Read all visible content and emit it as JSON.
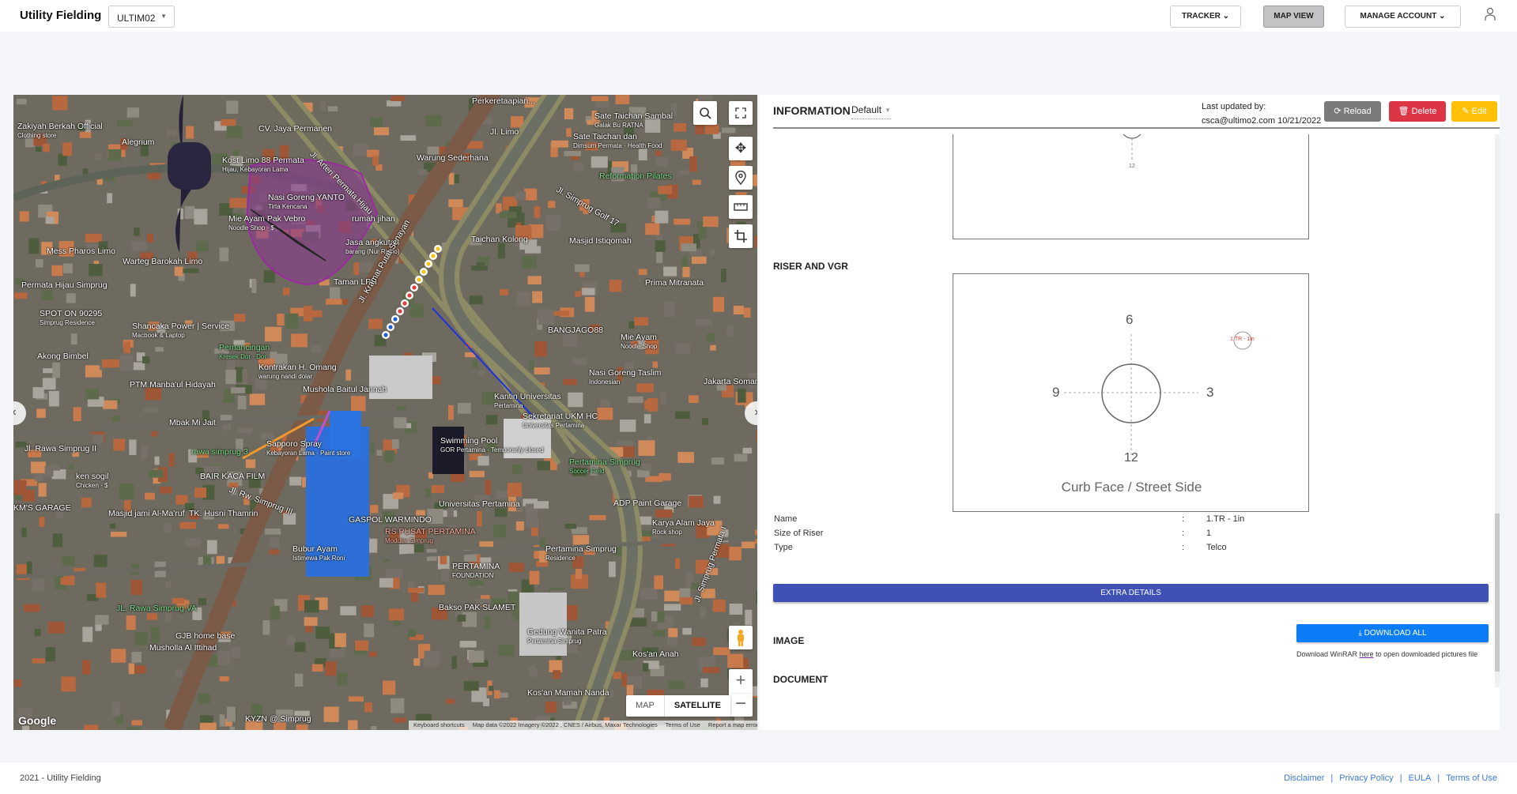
{
  "header": {
    "title": "Utility Fielding",
    "project_select": "ULTIM02",
    "nav": [
      {
        "label": "TRACKER",
        "icon": "chevron-down"
      },
      {
        "label": "MAP VIEW",
        "active": true
      },
      {
        "label": "MANAGE ACCOUNT",
        "icon": "chevron-down"
      }
    ],
    "user_icon": "user-icon"
  },
  "map": {
    "type_buttons": {
      "map": "MAP",
      "satellite": "SATELLITE",
      "selected": "SATELLITE"
    },
    "logo": "Google",
    "attribution": [
      "Keyboard shortcuts",
      "Map data ©2022 Imagery ©2022 , CNES / Airbus, Maxar Technologies",
      "Terms of Use",
      "Report a map error"
    ],
    "labels": [
      {
        "t": "Zakiyah Berkah Official",
        "s": "Clothing store"
      },
      {
        "t": "Alegrium"
      },
      {
        "t": "CV. Jaya Permanen"
      },
      {
        "t": "Kost Limo 88 Permata",
        "s": "Hijau, Kebayoran Lama"
      },
      {
        "t": "Nasi Goreng YANTO",
        "s": "Tirta Kencana"
      },
      {
        "t": "Mie Ayam Pak Vebro",
        "s": "Noodle Shop · $"
      },
      {
        "t": "Mess Pharos Limo"
      },
      {
        "t": "Warteg Barokah Limo"
      },
      {
        "t": "Permata Hijau Simprug"
      },
      {
        "t": "SPOT ON 90295",
        "s": "Simprug Residence"
      },
      {
        "t": "Shancaka Power | Service",
        "s": "Macbook & Laptop"
      },
      {
        "t": "Pemancingan",
        "s": "Kresek Dor - Dor"
      },
      {
        "t": "Akong Bimbel"
      },
      {
        "t": "Kontrakan H. Omang",
        "s": "warung nandi dolar"
      },
      {
        "t": "PTM Manba'ul Hidayah"
      },
      {
        "t": "Mushola Baitul Jannah"
      },
      {
        "t": "rumah jihan"
      },
      {
        "t": "Jasa angkutan",
        "s": "barang (Nur Ridho)"
      },
      {
        "t": "Taman LPH"
      },
      {
        "t": "Perkeretaapian..."
      },
      {
        "t": "Jl. Limo"
      },
      {
        "t": "Warung Sederhana"
      },
      {
        "t": "Sate Taichan Sambal",
        "s": "Galak Bu RATNA"
      },
      {
        "t": "Sate Taichan dan",
        "s": "Dimsum Permata · Health Food"
      },
      {
        "t": "Reformation Pilates"
      },
      {
        "t": "Taichan Kolong"
      },
      {
        "t": "Masjid Istiqomah"
      },
      {
        "t": "Prima Mitranata"
      },
      {
        "t": "BANGJAGO88"
      },
      {
        "t": "Mie Ayam",
        "s": "Noodle Shop"
      },
      {
        "t": "Nasi Goreng Taslim",
        "s": "Indonesian"
      },
      {
        "t": "Jakarta Soman"
      },
      {
        "t": "Kantin Universitas",
        "s": "Pertamina"
      },
      {
        "t": "Mbak Mi Jait"
      },
      {
        "t": "Jl. Rawa Simprug II"
      },
      {
        "t": "rawa simprug 3"
      },
      {
        "t": "Sapporo Spray",
        "s": "Kebayoran Lama · Paint store"
      },
      {
        "t": "BAIR KACA FILM"
      },
      {
        "t": "ken sogil",
        "s": "Chicken · $"
      },
      {
        "t": "KM'S GARAGE"
      },
      {
        "t": "Masjid jami Al-Ma'ruf"
      },
      {
        "t": "TK. Husni Thamrin"
      },
      {
        "t": "GASPOL WARMINDO"
      },
      {
        "t": "Bubur Ayam",
        "s": "Istimewa Pak Roni"
      },
      {
        "t": "JL. Rawa Simprug VA"
      },
      {
        "t": "GJB home base"
      },
      {
        "t": "Musholla Al Ittihad"
      },
      {
        "t": "KYZN @ Simprug"
      },
      {
        "t": "Sekretariat UKM HC",
        "s": "Universitas Pertamina"
      },
      {
        "t": "Swimming Pool",
        "s": "GOR Pertamina · Temporarily closed"
      },
      {
        "t": "Pertamina Simprug",
        "s": "Soccer Field"
      },
      {
        "t": "Universitas Pertamina"
      },
      {
        "t": "ADP Paint Garage"
      },
      {
        "t": "Karya Alam Jaya",
        "s": "Rock shop"
      },
      {
        "t": "RS PUSAT PERTAMINA",
        "s": "Modular Simprug"
      },
      {
        "t": "Pertamina Simprug",
        "s": "Residence"
      },
      {
        "t": "PERTAMINA",
        "s": "FOUNDATION"
      },
      {
        "t": "Bakso PAK SLAMET"
      },
      {
        "t": "Gedung Wanita Patra",
        "s": "Pertamina Simprug"
      },
      {
        "t": "Kos'an Anah"
      },
      {
        "t": "Kos'an Mamah Nanda"
      },
      {
        "t": "Jl. Arteri Permata Hijau"
      },
      {
        "t": "Jl. Simprug Golf 17"
      },
      {
        "t": "Jl. Kramat Putat Senayan"
      },
      {
        "t": "Jl. Rw. Simprug III"
      },
      {
        "t": "Jl. Simprug Permata I"
      }
    ]
  },
  "panel": {
    "title": "INFORMATION",
    "view_select": "Default",
    "last_updated_label": "Last updated by:",
    "last_updated_value": "csca@ultimo2.com 10/21/2022",
    "buttons": {
      "reload": "Reload",
      "delete": "Delete",
      "edit": "Edit"
    },
    "colors": {
      "reload": "#7a7a7a",
      "delete": "#dc3545",
      "edit": "#ffc107",
      "extra": "#3f51b5",
      "download": "#0d7cf7"
    },
    "prev_diagram_label": "12",
    "riser_section": "RISER AND VGR",
    "diagram": {
      "top": "6",
      "left": "9",
      "right": "3",
      "bottom": "12",
      "caption": "Curb Face / Street Side",
      "marker": "1.TR - 1in"
    },
    "fields": [
      {
        "label": "Name",
        "value": "1.TR - 1in"
      },
      {
        "label": "Size of Riser",
        "value": "1"
      },
      {
        "label": "Type",
        "value": "Telco"
      }
    ],
    "extra_details": "EXTRA DETAILS",
    "image_section": "IMAGE",
    "download_all": "DOWNLOAD ALL",
    "winrar_note": {
      "before": "Download WinRAR",
      "link": "here",
      "after": "to open downloaded pictures file"
    },
    "document_section": "DOCUMENT"
  },
  "footer": {
    "copyright": "2021 - Utility Fielding",
    "links": [
      "Disclaimer",
      "Privacy Policy",
      "EULA",
      "Terms of Use"
    ]
  }
}
